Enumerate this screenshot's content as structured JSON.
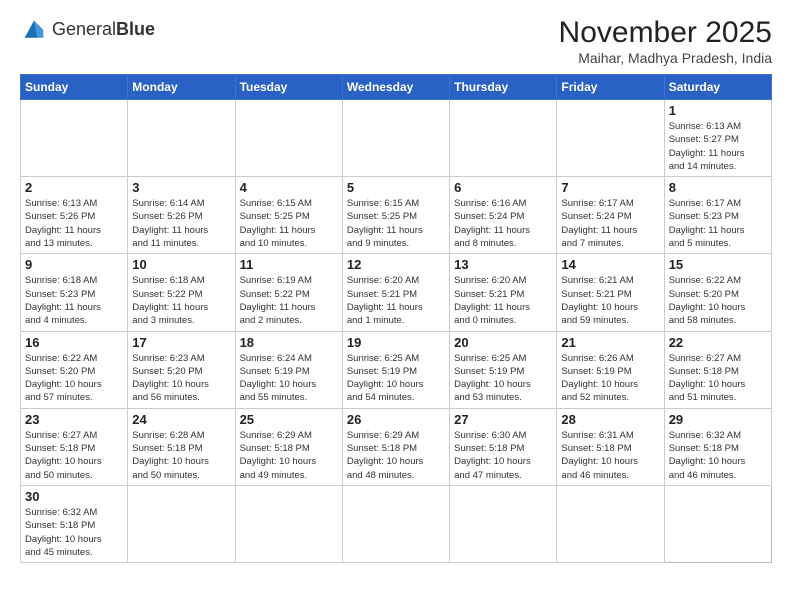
{
  "header": {
    "logo_text_normal": "General",
    "logo_text_bold": "Blue",
    "month_title": "November 2025",
    "location": "Maihar, Madhya Pradesh, India"
  },
  "weekdays": [
    "Sunday",
    "Monday",
    "Tuesday",
    "Wednesday",
    "Thursday",
    "Friday",
    "Saturday"
  ],
  "days": [
    {
      "num": "",
      "info": ""
    },
    {
      "num": "",
      "info": ""
    },
    {
      "num": "",
      "info": ""
    },
    {
      "num": "",
      "info": ""
    },
    {
      "num": "",
      "info": ""
    },
    {
      "num": "",
      "info": ""
    },
    {
      "num": "1",
      "info": "Sunrise: 6:13 AM\nSunset: 5:27 PM\nDaylight: 11 hours\nand 14 minutes."
    },
    {
      "num": "2",
      "info": "Sunrise: 6:13 AM\nSunset: 5:26 PM\nDaylight: 11 hours\nand 13 minutes."
    },
    {
      "num": "3",
      "info": "Sunrise: 6:14 AM\nSunset: 5:26 PM\nDaylight: 11 hours\nand 11 minutes."
    },
    {
      "num": "4",
      "info": "Sunrise: 6:15 AM\nSunset: 5:25 PM\nDaylight: 11 hours\nand 10 minutes."
    },
    {
      "num": "5",
      "info": "Sunrise: 6:15 AM\nSunset: 5:25 PM\nDaylight: 11 hours\nand 9 minutes."
    },
    {
      "num": "6",
      "info": "Sunrise: 6:16 AM\nSunset: 5:24 PM\nDaylight: 11 hours\nand 8 minutes."
    },
    {
      "num": "7",
      "info": "Sunrise: 6:17 AM\nSunset: 5:24 PM\nDaylight: 11 hours\nand 7 minutes."
    },
    {
      "num": "8",
      "info": "Sunrise: 6:17 AM\nSunset: 5:23 PM\nDaylight: 11 hours\nand 5 minutes."
    },
    {
      "num": "9",
      "info": "Sunrise: 6:18 AM\nSunset: 5:23 PM\nDaylight: 11 hours\nand 4 minutes."
    },
    {
      "num": "10",
      "info": "Sunrise: 6:18 AM\nSunset: 5:22 PM\nDaylight: 11 hours\nand 3 minutes."
    },
    {
      "num": "11",
      "info": "Sunrise: 6:19 AM\nSunset: 5:22 PM\nDaylight: 11 hours\nand 2 minutes."
    },
    {
      "num": "12",
      "info": "Sunrise: 6:20 AM\nSunset: 5:21 PM\nDaylight: 11 hours\nand 1 minute."
    },
    {
      "num": "13",
      "info": "Sunrise: 6:20 AM\nSunset: 5:21 PM\nDaylight: 11 hours\nand 0 minutes."
    },
    {
      "num": "14",
      "info": "Sunrise: 6:21 AM\nSunset: 5:21 PM\nDaylight: 10 hours\nand 59 minutes."
    },
    {
      "num": "15",
      "info": "Sunrise: 6:22 AM\nSunset: 5:20 PM\nDaylight: 10 hours\nand 58 minutes."
    },
    {
      "num": "16",
      "info": "Sunrise: 6:22 AM\nSunset: 5:20 PM\nDaylight: 10 hours\nand 57 minutes."
    },
    {
      "num": "17",
      "info": "Sunrise: 6:23 AM\nSunset: 5:20 PM\nDaylight: 10 hours\nand 56 minutes."
    },
    {
      "num": "18",
      "info": "Sunrise: 6:24 AM\nSunset: 5:19 PM\nDaylight: 10 hours\nand 55 minutes."
    },
    {
      "num": "19",
      "info": "Sunrise: 6:25 AM\nSunset: 5:19 PM\nDaylight: 10 hours\nand 54 minutes."
    },
    {
      "num": "20",
      "info": "Sunrise: 6:25 AM\nSunset: 5:19 PM\nDaylight: 10 hours\nand 53 minutes."
    },
    {
      "num": "21",
      "info": "Sunrise: 6:26 AM\nSunset: 5:19 PM\nDaylight: 10 hours\nand 52 minutes."
    },
    {
      "num": "22",
      "info": "Sunrise: 6:27 AM\nSunset: 5:18 PM\nDaylight: 10 hours\nand 51 minutes."
    },
    {
      "num": "23",
      "info": "Sunrise: 6:27 AM\nSunset: 5:18 PM\nDaylight: 10 hours\nand 50 minutes."
    },
    {
      "num": "24",
      "info": "Sunrise: 6:28 AM\nSunset: 5:18 PM\nDaylight: 10 hours\nand 50 minutes."
    },
    {
      "num": "25",
      "info": "Sunrise: 6:29 AM\nSunset: 5:18 PM\nDaylight: 10 hours\nand 49 minutes."
    },
    {
      "num": "26",
      "info": "Sunrise: 6:29 AM\nSunset: 5:18 PM\nDaylight: 10 hours\nand 48 minutes."
    },
    {
      "num": "27",
      "info": "Sunrise: 6:30 AM\nSunset: 5:18 PM\nDaylight: 10 hours\nand 47 minutes."
    },
    {
      "num": "28",
      "info": "Sunrise: 6:31 AM\nSunset: 5:18 PM\nDaylight: 10 hours\nand 46 minutes."
    },
    {
      "num": "29",
      "info": "Sunrise: 6:32 AM\nSunset: 5:18 PM\nDaylight: 10 hours\nand 46 minutes."
    },
    {
      "num": "30",
      "info": "Sunrise: 6:32 AM\nSunset: 5:18 PM\nDaylight: 10 hours\nand 45 minutes."
    },
    {
      "num": "",
      "info": ""
    },
    {
      "num": "",
      "info": ""
    },
    {
      "num": "",
      "info": ""
    },
    {
      "num": "",
      "info": ""
    },
    {
      "num": "",
      "info": ""
    }
  ]
}
